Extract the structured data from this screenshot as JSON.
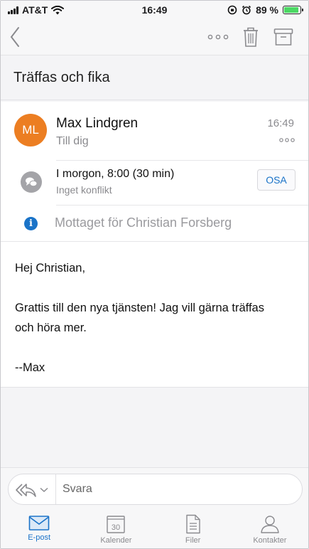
{
  "status_bar": {
    "carrier": "AT&T",
    "time": "16:49",
    "battery_percent": "89 %",
    "battery_level": 0.89
  },
  "toolbar": {
    "back_icon": "chevron-left-icon",
    "more_icon": "more-horizontal-icon",
    "delete_icon": "trash-icon",
    "archive_icon": "archive-icon"
  },
  "message": {
    "subject": "Träffas och fika",
    "sender": {
      "initials": "ML",
      "name": "Max Lindgren",
      "recipient": "Till dig",
      "time": "16:49",
      "avatar_color": "#ec7e22"
    },
    "event": {
      "title": "I morgon, 8:00 (30 min)",
      "conflict": "Inget konflikt",
      "rsvp_label": "OSA"
    },
    "received_for": "Mottaget för Christian Forsberg",
    "body": {
      "greeting": "Hej Christian,",
      "paragraph": "Grattis till den nya tjänsten! Jag vill gärna träffas och höra mer.",
      "signature": "--Max"
    }
  },
  "reply": {
    "placeholder": "Svara"
  },
  "tabs": [
    {
      "label": "E-post",
      "icon": "mail-icon",
      "active": true
    },
    {
      "label": "Kalender",
      "icon": "calendar-icon",
      "badge": "30",
      "active": false
    },
    {
      "label": "Filer",
      "icon": "file-icon",
      "active": false
    },
    {
      "label": "Kontakter",
      "icon": "contact-icon",
      "active": false
    }
  ],
  "colors": {
    "accent": "#1a73c8",
    "battery": "#4cd964"
  }
}
